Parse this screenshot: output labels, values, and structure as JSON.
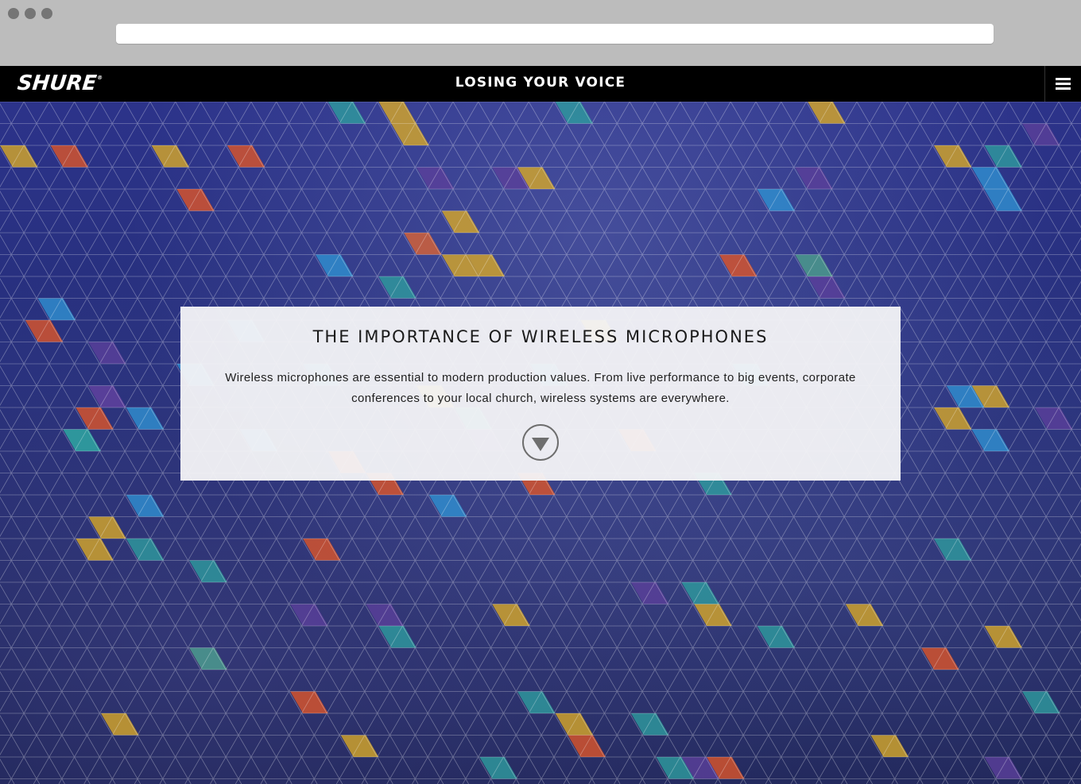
{
  "header": {
    "logo_text": "SHURE",
    "logo_mark": "®",
    "title": "LOSING YOUR VOICE",
    "menu_icon": "hamburger-menu-icon"
  },
  "card": {
    "heading": "THE IMPORTANCE OF WIRELESS MICROPHONES",
    "body": "Wireless microphones are essential to modern production values. From live performance to big events, corporate conferences to your local church, wireless systems are everywhere.",
    "scroll_icon": "down-arrow-circle-icon"
  },
  "colors": {
    "header_bg": "#000000",
    "hero_base": "#262f7a",
    "tile_orange": "#d9542b",
    "tile_teal": "#2e9a9e",
    "tile_yellow": "#d4a62a",
    "tile_blue": "#2f8fd0",
    "tile_purple": "#5a3f9a"
  }
}
